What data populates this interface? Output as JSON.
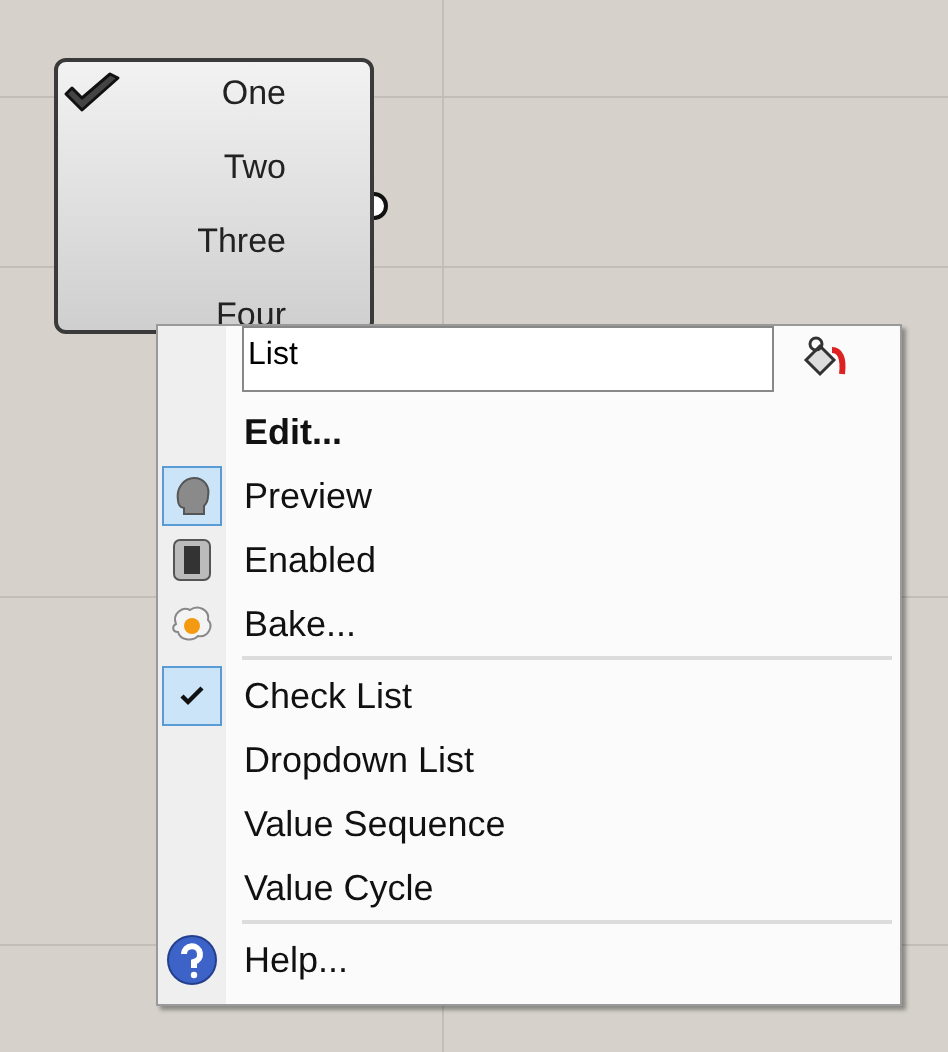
{
  "node": {
    "items": [
      "One",
      "Two",
      "Three",
      "Four"
    ]
  },
  "menu": {
    "name_field": {
      "value": "List"
    },
    "sections": [
      [
        {
          "label": "Edit...",
          "kind": "default"
        },
        {
          "label": "Preview",
          "kind": "toggle",
          "checked": true
        },
        {
          "label": "Enabled",
          "kind": "toggle",
          "checked": false
        },
        {
          "label": "Bake...",
          "kind": "command"
        }
      ],
      [
        {
          "label": "Check List",
          "kind": "option",
          "checked": true
        },
        {
          "label": "Dropdown List",
          "kind": "option",
          "checked": false
        },
        {
          "label": "Value Sequence",
          "kind": "option",
          "checked": false
        },
        {
          "label": "Value Cycle",
          "kind": "option",
          "checked": false
        }
      ],
      [
        {
          "label": "Help...",
          "kind": "command"
        }
      ]
    ]
  }
}
